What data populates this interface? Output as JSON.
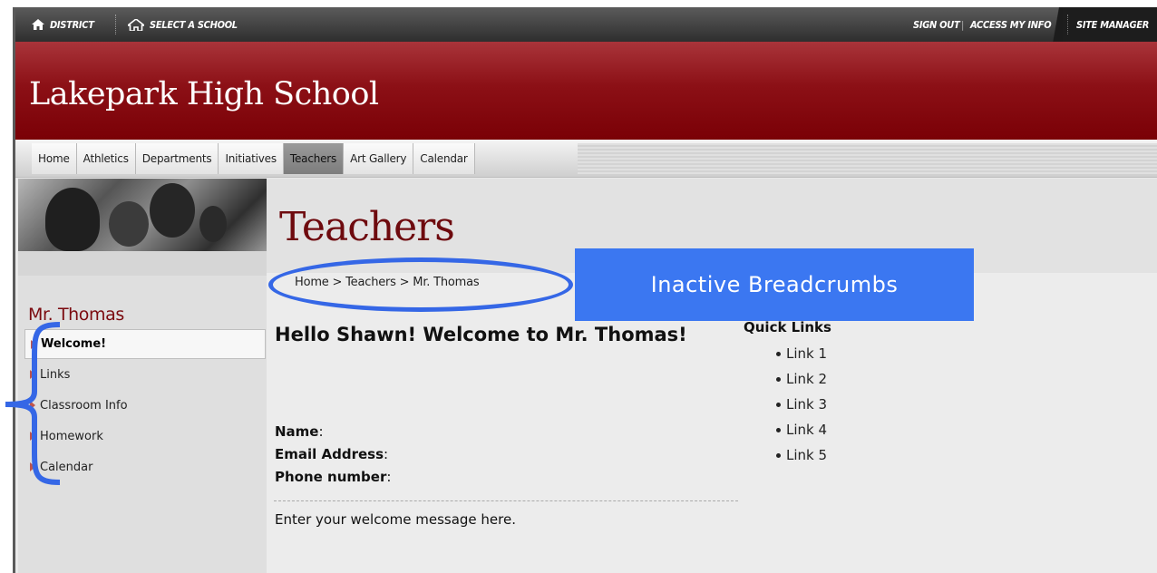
{
  "topbar": {
    "district": "DISTRICT",
    "select_school": "SELECT A SCHOOL",
    "sign_out": "SIGN OUT",
    "separator": "|",
    "access_info": "ACCESS MY INFO",
    "site_manager": "SITE MANAGER"
  },
  "header": {
    "school_name": "Lakepark High School"
  },
  "nav": {
    "tabs": [
      "Home",
      "Athletics",
      "Departments",
      "Initiatives",
      "Teachers",
      "Art Gallery",
      "Calendar"
    ],
    "active": "Teachers"
  },
  "banner": {
    "title": "Teachers"
  },
  "breadcrumb": "Home > Teachers > Mr. Thomas",
  "sidebar": {
    "title": "Mr. Thomas",
    "items": [
      "Welcome!",
      "Links",
      "Classroom Info",
      "Homework",
      "Calendar"
    ],
    "active": "Welcome!"
  },
  "main": {
    "welcome_heading": "Hello Shawn! Welcome to Mr. Thomas!",
    "fields": {
      "name": "Name",
      "email": "Email Address",
      "phone": "Phone number",
      "colon": ":"
    },
    "message": "Enter your welcome message here."
  },
  "quick_links": {
    "title": "Quick Links",
    "items": [
      "Link 1",
      "Link 2",
      "Link 3",
      "Link 4",
      "Link 5"
    ]
  },
  "annotation": {
    "label": "Inactive Breadcrumbs",
    "color": "#3567e6"
  },
  "colors": {
    "header_red": "#8c1016",
    "title_red": "#6e0a0e",
    "topbar": "#2e2e2e"
  }
}
